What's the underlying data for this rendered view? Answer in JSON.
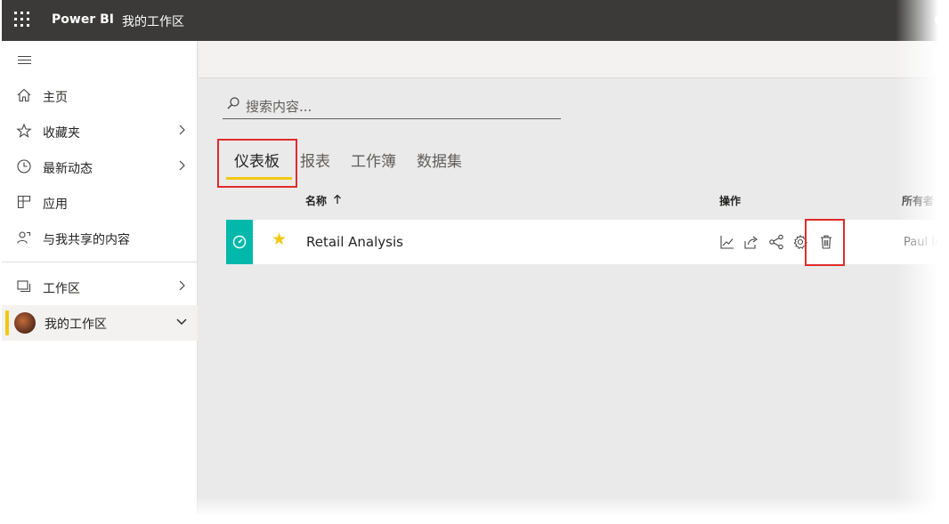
{
  "topbar": {
    "app_name": "Power BI",
    "breadcrumb": "我的工作区"
  },
  "sidebar": {
    "items": [
      {
        "label": "主页",
        "icon": "home-icon"
      },
      {
        "label": "收藏夹",
        "icon": "star-outline-icon",
        "has_chevron": true
      },
      {
        "label": "最新动态",
        "icon": "clock-icon",
        "has_chevron": true
      },
      {
        "label": "应用",
        "icon": "apps-icon"
      },
      {
        "label": "与我共享的内容",
        "icon": "shared-with-me-icon"
      },
      {
        "label": "工作区",
        "icon": "workspaces-icon",
        "has_chevron": true
      },
      {
        "label": "我的工作区",
        "icon": "avatar",
        "active": true,
        "expanded": true
      }
    ]
  },
  "search": {
    "placeholder": "搜索内容..."
  },
  "tabs": [
    {
      "label": "仪表板",
      "selected": true
    },
    {
      "label": "报表"
    },
    {
      "label": "工作簿"
    },
    {
      "label": "数据集"
    }
  ],
  "table": {
    "columns": {
      "name": "名称",
      "actions": "操作",
      "owner": "所有者"
    },
    "sort": "ascending",
    "rows": [
      {
        "name": "Retail Analysis",
        "favorite": true,
        "owner": "Paul Int",
        "actions": [
          "insights-icon",
          "share-icon",
          "connections-icon",
          "settings-icon",
          "delete-icon"
        ]
      }
    ]
  },
  "colors": {
    "topbar": "#3b3a39",
    "accent": "#f2c811",
    "tile": "#01b8aa",
    "highlight": "#e02b2b"
  }
}
